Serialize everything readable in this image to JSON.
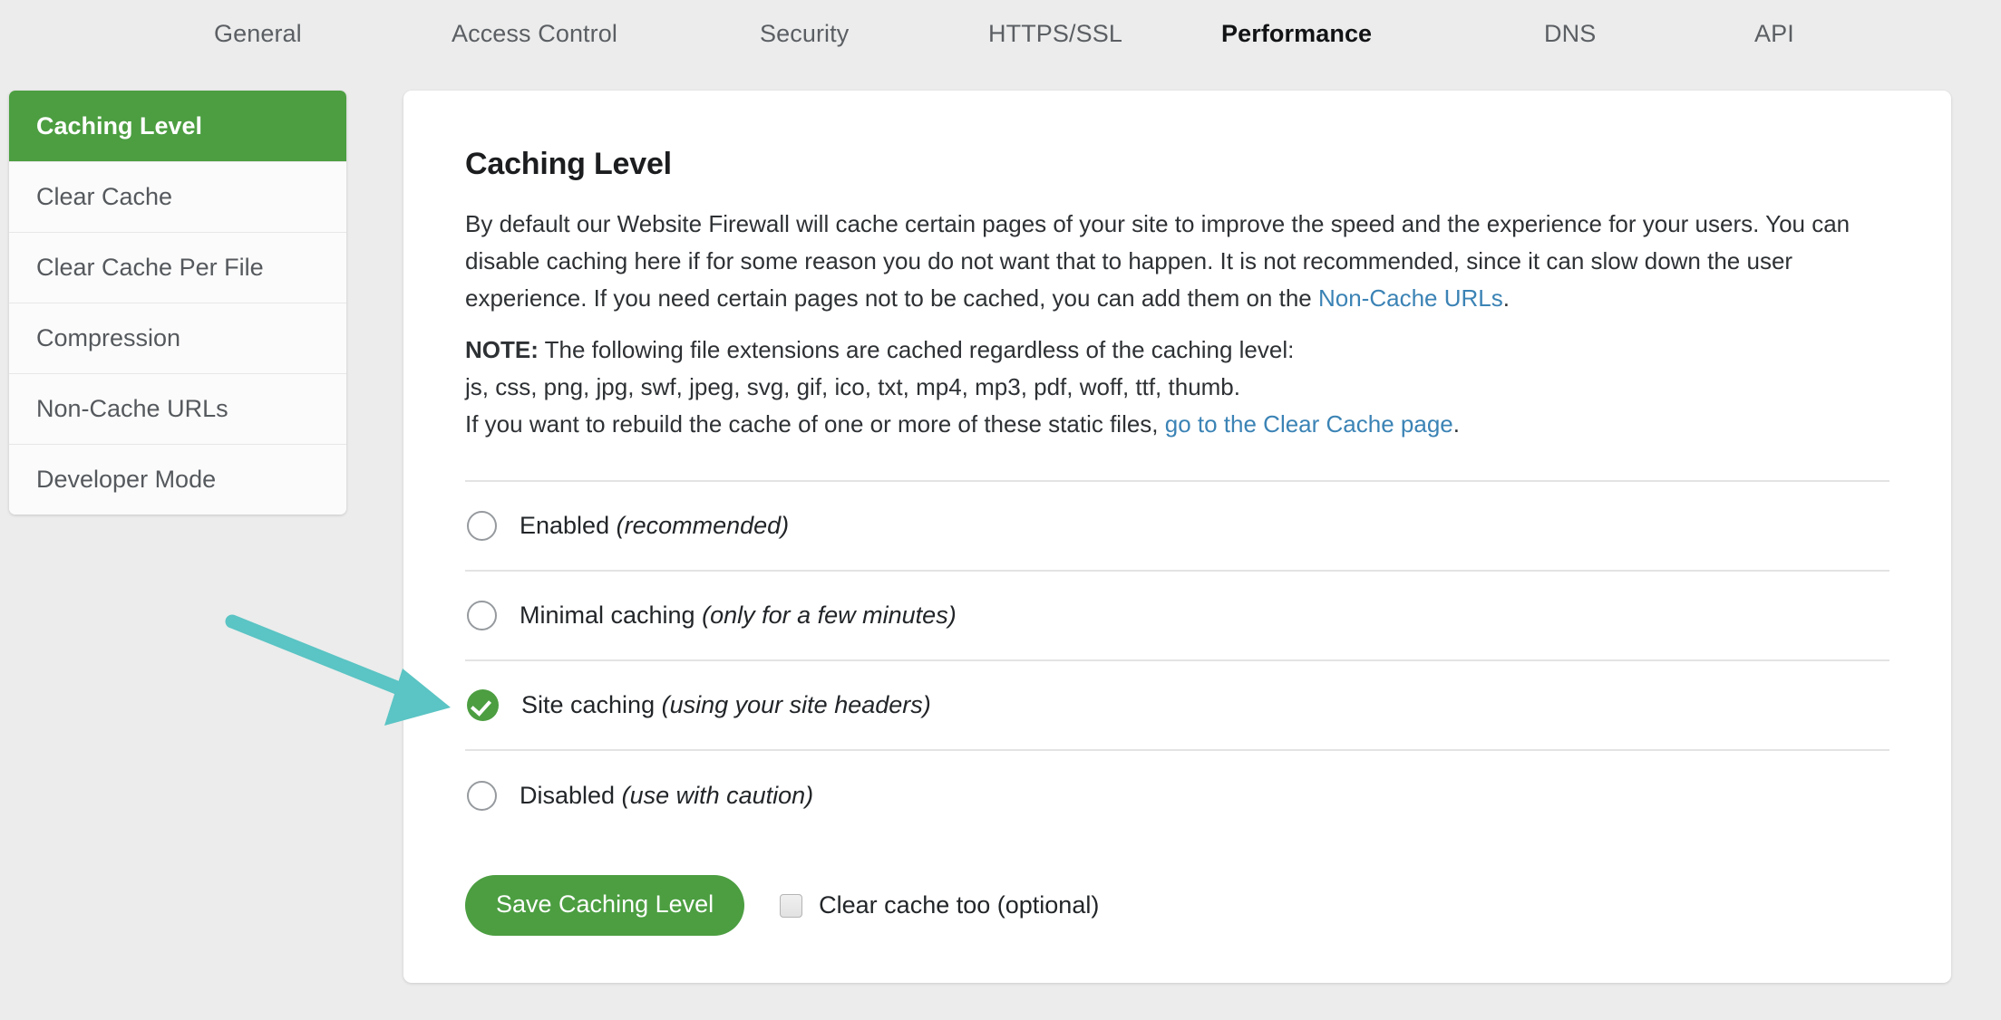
{
  "topnav": {
    "tabs": [
      {
        "label": "General",
        "active": false
      },
      {
        "label": "Access Control",
        "active": false
      },
      {
        "label": "Security",
        "active": false
      },
      {
        "label": "HTTPS/SSL",
        "active": false
      },
      {
        "label": "Performance",
        "active": true
      },
      {
        "label": "DNS",
        "active": false
      },
      {
        "label": "API",
        "active": false
      }
    ]
  },
  "sidebar": {
    "items": [
      {
        "label": "Caching Level",
        "active": true
      },
      {
        "label": "Clear Cache",
        "active": false
      },
      {
        "label": "Clear Cache Per File",
        "active": false
      },
      {
        "label": "Compression",
        "active": false
      },
      {
        "label": "Non-Cache URLs",
        "active": false
      },
      {
        "label": "Developer Mode",
        "active": false
      }
    ]
  },
  "main": {
    "title": "Caching Level",
    "intro_part1": "By default our Website Firewall will cache certain pages of your site to improve the speed and the experience for your users. You can disable caching here if for some reason you do not want that to happen. It is not recommended, since it can slow down the user experience. If you need certain pages not to be cached, you can add them on the ",
    "intro_link": "Non-Cache URLs",
    "intro_part2": ".",
    "note_label": "NOTE:",
    "note_text": " The following file extensions are cached regardless of the caching level:",
    "extensions": "js, css, png, jpg, swf, jpeg, svg, gif, ico, txt, mp4, mp3, pdf, woff, ttf, thumb.",
    "rebuild_part1": "If you want to rebuild the cache of one or more of these static files, ",
    "rebuild_link": "go to the Clear Cache page",
    "rebuild_part2": ".",
    "options": [
      {
        "label": "Enabled",
        "hint": "(recommended)",
        "selected": false
      },
      {
        "label": "Minimal caching",
        "hint": "(only for a few minutes)",
        "selected": false
      },
      {
        "label": "Site caching",
        "hint": "(using your site headers)",
        "selected": true
      },
      {
        "label": "Disabled",
        "hint": "(use with caution)",
        "selected": false
      }
    ],
    "save_label": "Save Caching Level",
    "clear_cache_too_label": "Clear cache too (optional)",
    "clear_cache_too_checked": false
  },
  "annotation": {
    "arrow_color": "#5bc4c4",
    "arrow_name": "pointer-arrow"
  },
  "colors": {
    "brand_green": "#4c9e41",
    "link_blue": "#3b83b5",
    "page_bg": "#ececec",
    "card_bg": "#ffffff"
  }
}
